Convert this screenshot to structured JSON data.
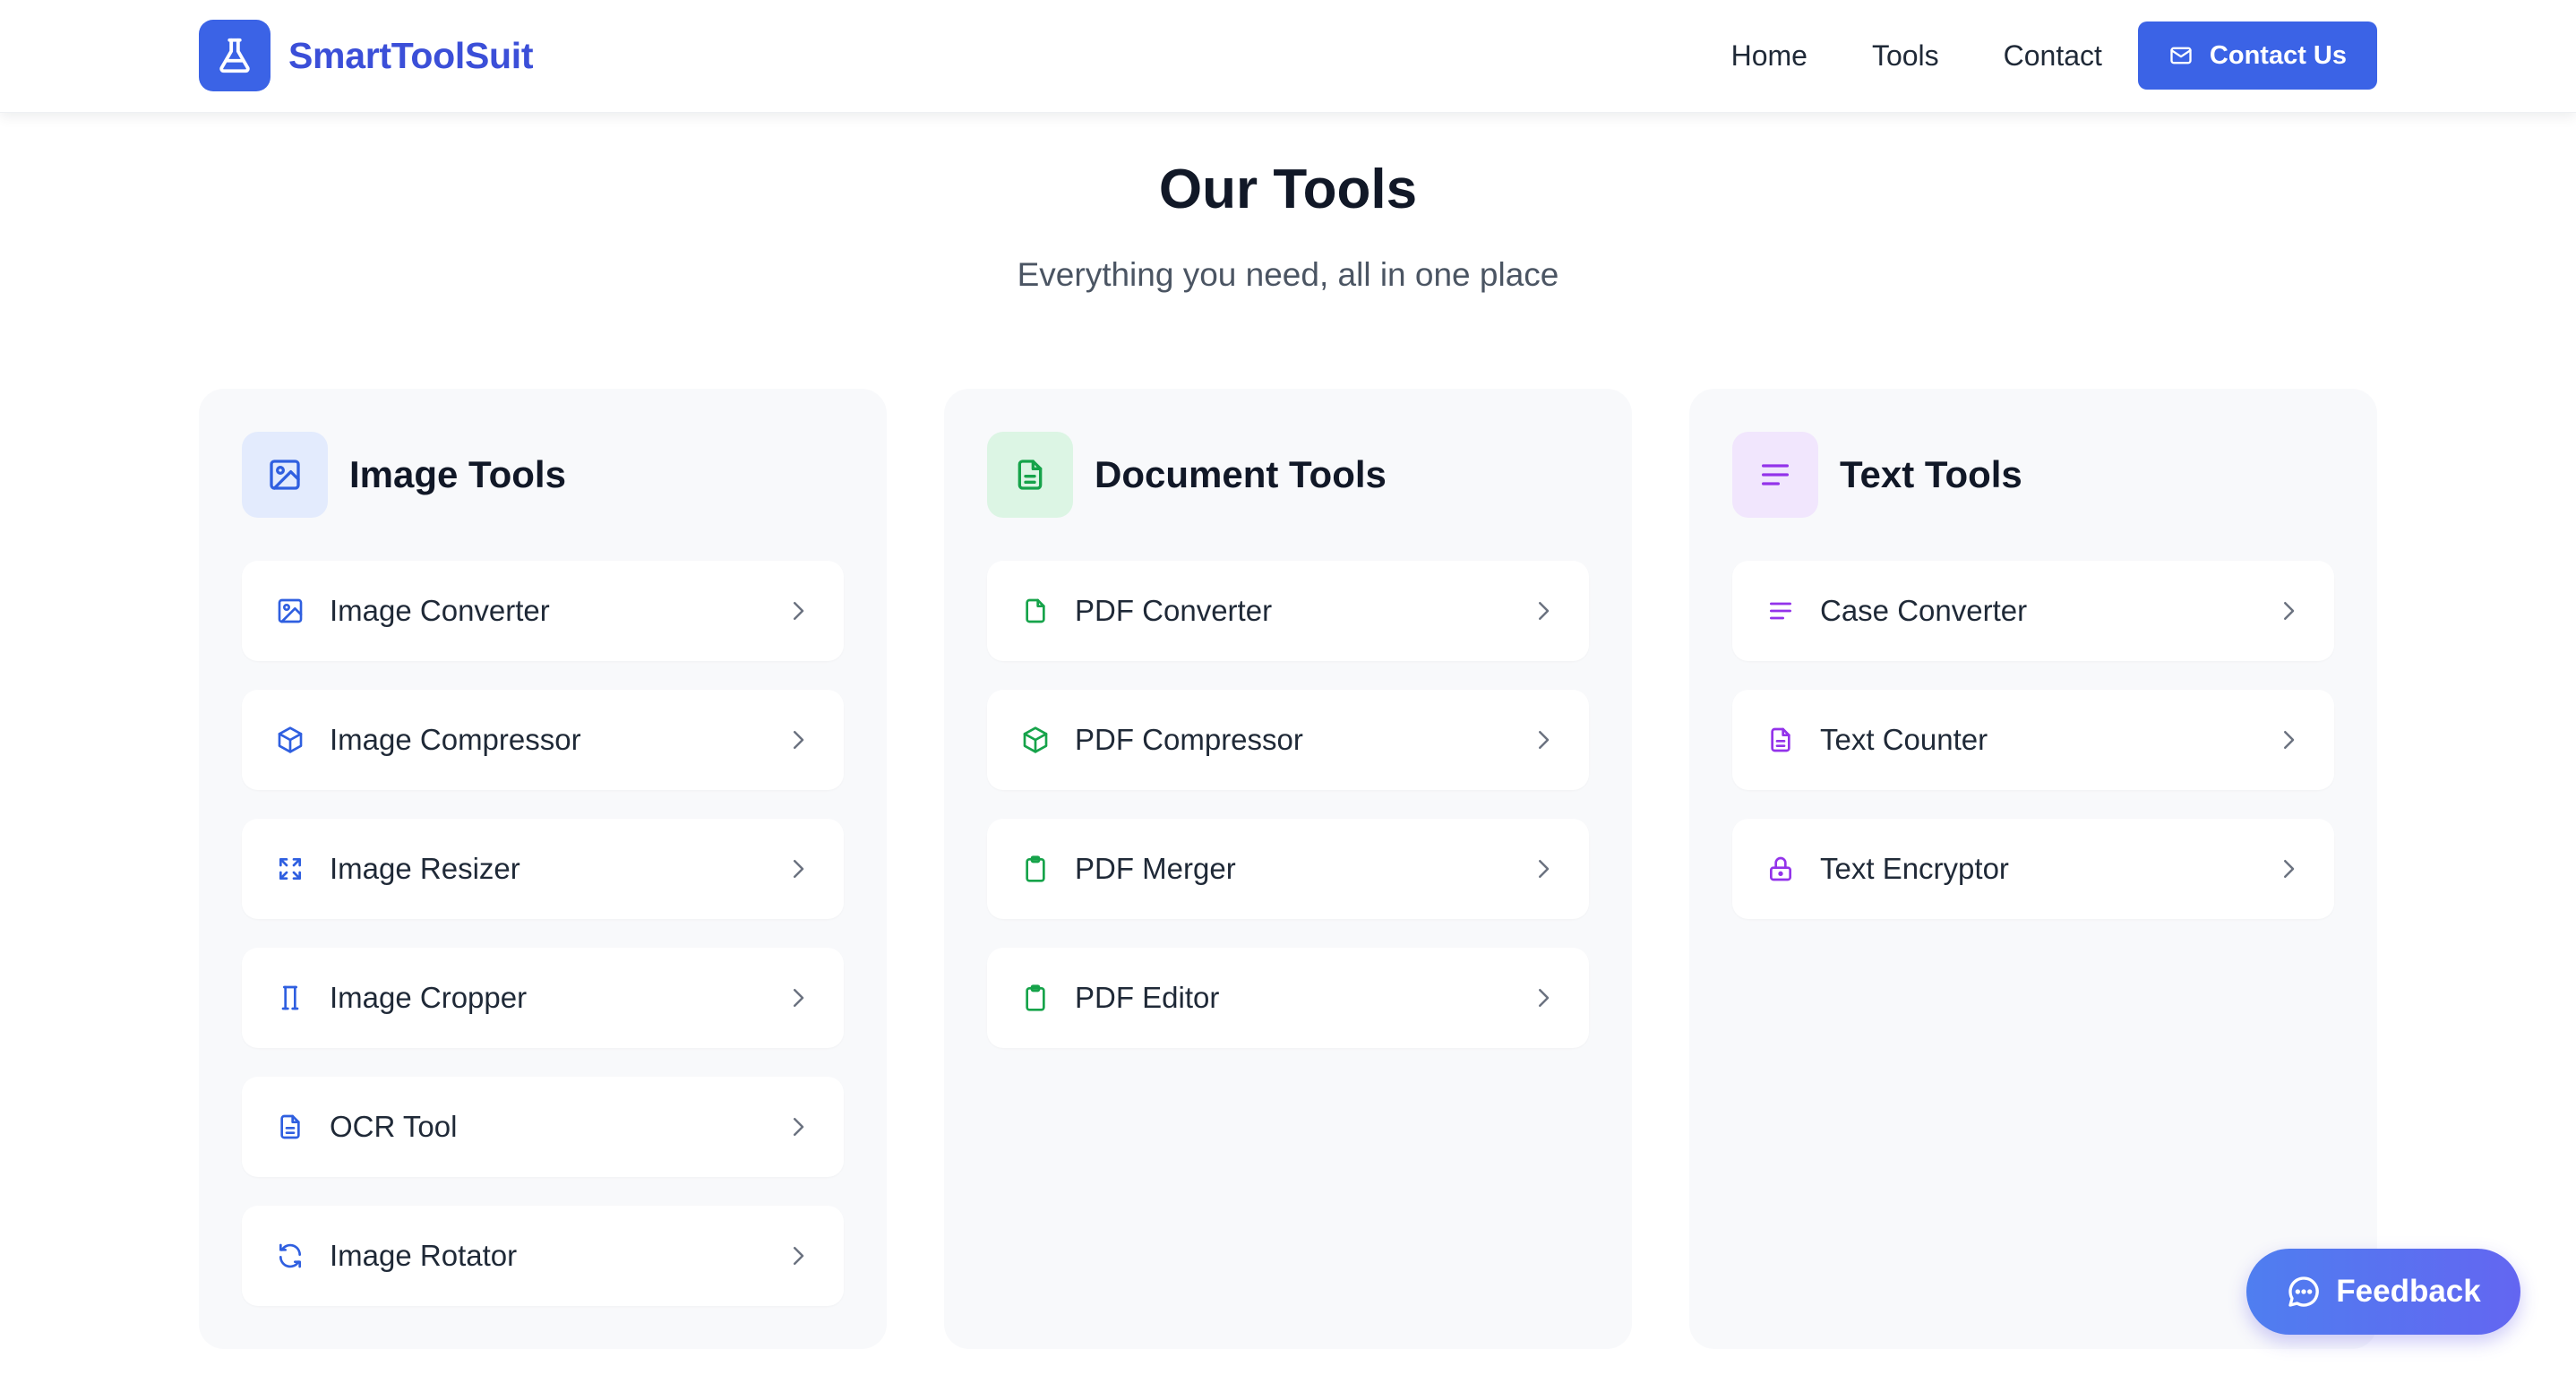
{
  "brand": {
    "name": "SmartToolSuit",
    "logo_icon": "flask-icon",
    "color": "#3b4fd8"
  },
  "nav": {
    "links": [
      {
        "label": "Home"
      },
      {
        "label": "Tools"
      },
      {
        "label": "Contact"
      }
    ],
    "cta": {
      "label": "Contact Us",
      "icon": "mail-icon",
      "color": "#3b63e6"
    }
  },
  "hero": {
    "title": "Our Tools",
    "subtitle": "Everything you need, all in one place"
  },
  "categories": [
    {
      "title": "Image Tools",
      "accent": "#2f5fe0",
      "icon_bg": "#e3ebfd",
      "icon": "image-icon",
      "items": [
        {
          "label": "Image Converter",
          "icon": "image-icon"
        },
        {
          "label": "Image Compressor",
          "icon": "box-icon"
        },
        {
          "label": "Image Resizer",
          "icon": "expand-icon"
        },
        {
          "label": "Image Cropper",
          "icon": "crop-icon"
        },
        {
          "label": "OCR Tool",
          "icon": "document-icon"
        },
        {
          "label": "Image Rotator",
          "icon": "rotate-icon"
        }
      ]
    },
    {
      "title": "Document Tools",
      "accent": "#16a34a",
      "icon_bg": "#dcf5e4",
      "icon": "document-icon",
      "items": [
        {
          "label": "PDF Converter",
          "icon": "file-icon"
        },
        {
          "label": "PDF Compressor",
          "icon": "box-icon"
        },
        {
          "label": "PDF Merger",
          "icon": "clipboard-icon"
        },
        {
          "label": "PDF Editor",
          "icon": "clipboard-icon"
        }
      ]
    },
    {
      "title": "Text Tools",
      "accent": "#9333ea",
      "icon_bg": "#f1e6fd",
      "icon": "text-lines-icon",
      "items": [
        {
          "label": "Case Converter",
          "icon": "text-lines-icon"
        },
        {
          "label": "Text Counter",
          "icon": "document-icon"
        },
        {
          "label": "Text Encryptor",
          "icon": "lock-icon"
        }
      ]
    }
  ],
  "feedback": {
    "label": "Feedback",
    "icon": "chat-bubble-icon"
  }
}
